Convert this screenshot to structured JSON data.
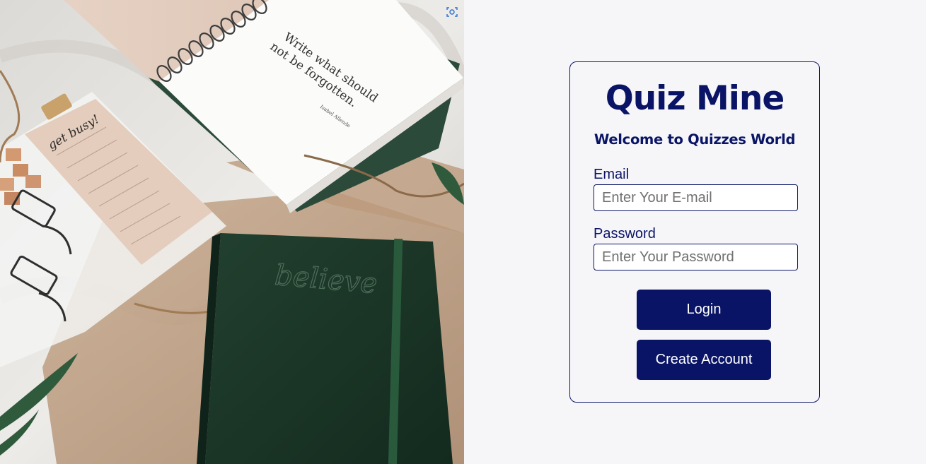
{
  "hero": {
    "notebook_quote": "Write what should not be forgotten.",
    "quote_author": "Isabel Allende",
    "notepad_text": "get busy!",
    "journal_cover_text": "believe",
    "lens_icon": "visual-search-icon"
  },
  "login": {
    "brand_title": "Quiz Mine",
    "welcome_text": "Welcome to Quizzes World",
    "email_label": "Email",
    "email_placeholder": "Enter Your E-mail",
    "password_label": "Password",
    "password_placeholder": "Enter Your Password",
    "login_button": "Login",
    "create_account_button": "Create Account"
  },
  "colors": {
    "brand": "#0a1466",
    "page_background": "#f6f6f9",
    "journal_green": "#1d3a2a"
  }
}
